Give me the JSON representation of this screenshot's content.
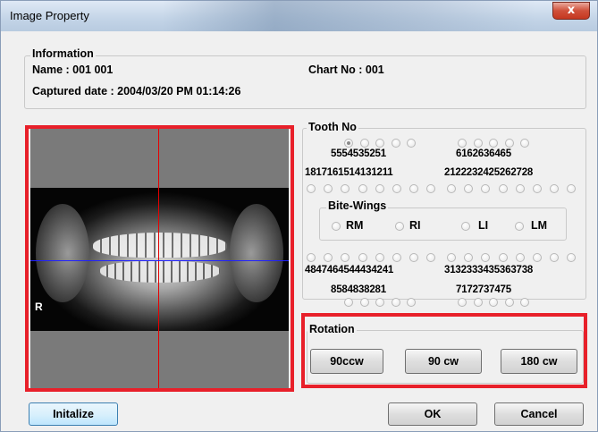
{
  "window": {
    "title": "Image Property",
    "close_label": "x"
  },
  "information": {
    "group_label": "Information",
    "name_label": "Name : 001 001",
    "chart_label": "Chart No : 001",
    "captured_label": "Captured date : 2004/03/20 PM 01:14:26"
  },
  "preview": {
    "marker": "R"
  },
  "tooth": {
    "group_label": "Tooth  No",
    "upper_primary_right": "55 54 53 52 51",
    "upper_primary_left": "61 62 63 64 65",
    "upper_perm_right": "18 17 16 15 14 13 12 11",
    "upper_perm_left": "21 22 23 24 25 26 27 28",
    "lower_perm_right": "48 47 46 45 44 43 42 41",
    "lower_perm_left": "31 32 33 34 35 36 37 38",
    "lower_primary_right": "85 84 83 82 81",
    "lower_primary_left": "71 72 73 74 75",
    "selected": "55"
  },
  "bitewings": {
    "group_label": "Bite-Wings",
    "options": [
      "RM",
      "RI",
      "LI",
      "LM"
    ]
  },
  "rotation": {
    "group_label": "Rotation",
    "buttons": [
      "90ccw",
      "90 cw",
      "180 cw"
    ]
  },
  "footer": {
    "initialize_label": "Initalize",
    "ok_label": "OK",
    "cancel_label": "Cancel"
  },
  "colors": {
    "highlight": "#e8202a",
    "crosshair_v": "#e60000",
    "crosshair_h": "#2020ff"
  }
}
